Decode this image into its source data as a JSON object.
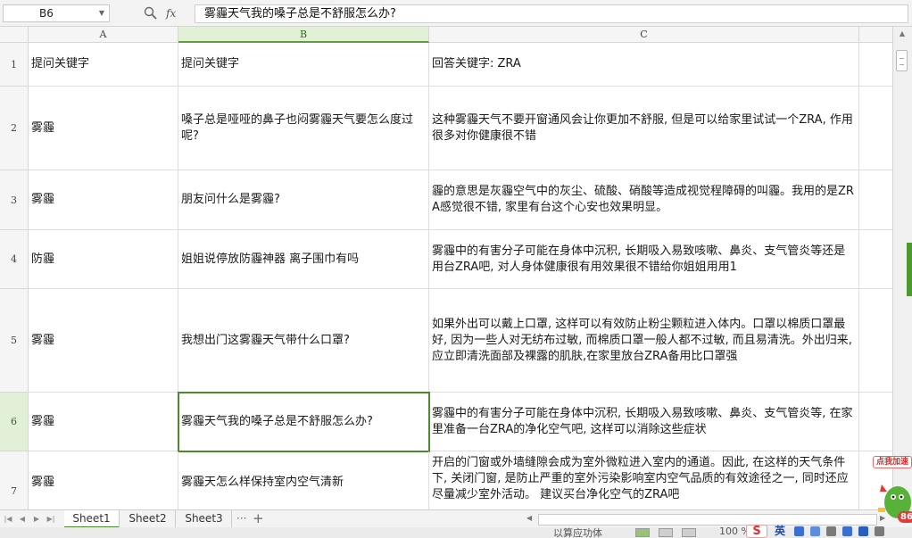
{
  "formula_bar": {
    "name_box": "B6",
    "fx_label": "fx",
    "formula": "雾霾天气我的嗓子总是不舒服怎么办?"
  },
  "columns": [
    "A",
    "B",
    "C"
  ],
  "selected_column": "B",
  "selected_row": "6",
  "rows": [
    {
      "num": "1",
      "a": "提问关键字",
      "b": "提问关键字",
      "c": "回答关键字: ZRA"
    },
    {
      "num": "2",
      "a": "雾霾",
      "b": "嗓子总是哑哑的鼻子也闷雾霾天气要怎么度过呢?",
      "c": "这种雾霾天气不要开窗通风会让你更加不舒服, 但是可以给家里试试一个ZRA, 作用很多对你健康很不错"
    },
    {
      "num": "3",
      "a": "雾霾",
      "b": "朋友问什么是雾霾?",
      "c": "霾的意思是灰霾空气中的灰尘、硫酸、硝酸等造成视觉程障碍的叫霾。我用的是ZRA感觉很不错, 家里有台这个心安也效果明显。"
    },
    {
      "num": "4",
      "a": "防霾",
      "b": "姐姐说停放防霾神器 离子围巾有吗",
      "c": "雾霾中的有害分子可能在身体中沉积, 长期吸入易致咳嗽、鼻炎、支气管炎等还是用台ZRA吧, 对人身体健康很有用效果很不错给你姐姐用用1"
    },
    {
      "num": "5",
      "a": "雾霾",
      "b": "我想出门这雾霾天气带什么口罩?",
      "c": "如果外出可以戴上口罩, 这样可以有效防止粉尘颗粒进入体内。口罩以棉质口罩最好, 因为一些人对无纺布过敏, 而棉质口罩一般人都不过敏, 而且易清洗。外出归来, 应立即清洗面部及裸露的肌肤,在家里放台ZRA备用比口罩强"
    },
    {
      "num": "6",
      "a": "雾霾",
      "b": "雾霾天气我的嗓子总是不舒服怎么办?",
      "c": "雾霾中的有害分子可能在身体中沉积, 长期吸入易致咳嗽、鼻炎、支气管炎等, 在家里准备一台ZRA的净化空气吧, 这样可以消除这些症状"
    },
    {
      "num": "7",
      "a": "雾霾",
      "b": "雾霾天怎么样保持室内空气清新",
      "c": "开启的门窗或外墙缝隙会成为室外微粒进入室内的通道。因此, 在这样的天气条件下, 关闭门窗, 是防止严重的室外污染影响室内空气品质的有效途径之一, 同时还应尽量减少室外活动。 建议买台净化空气的ZRA吧"
    }
  ],
  "sheets": [
    "Sheet1",
    "Sheet2",
    "Sheet3"
  ],
  "active_sheet": "Sheet1",
  "sheet_more": "···",
  "sheet_add": "+",
  "status": {
    "text": "以算应功体",
    "zoom": "100 %"
  },
  "float_widget": {
    "label": "点我加速",
    "number": "86"
  },
  "tray": {
    "s_logo": "S",
    "ime": "英"
  },
  "colors": {
    "accent": "#4d8a2e",
    "header_active": "#e3f0d8",
    "grid_line": "#dedede"
  }
}
